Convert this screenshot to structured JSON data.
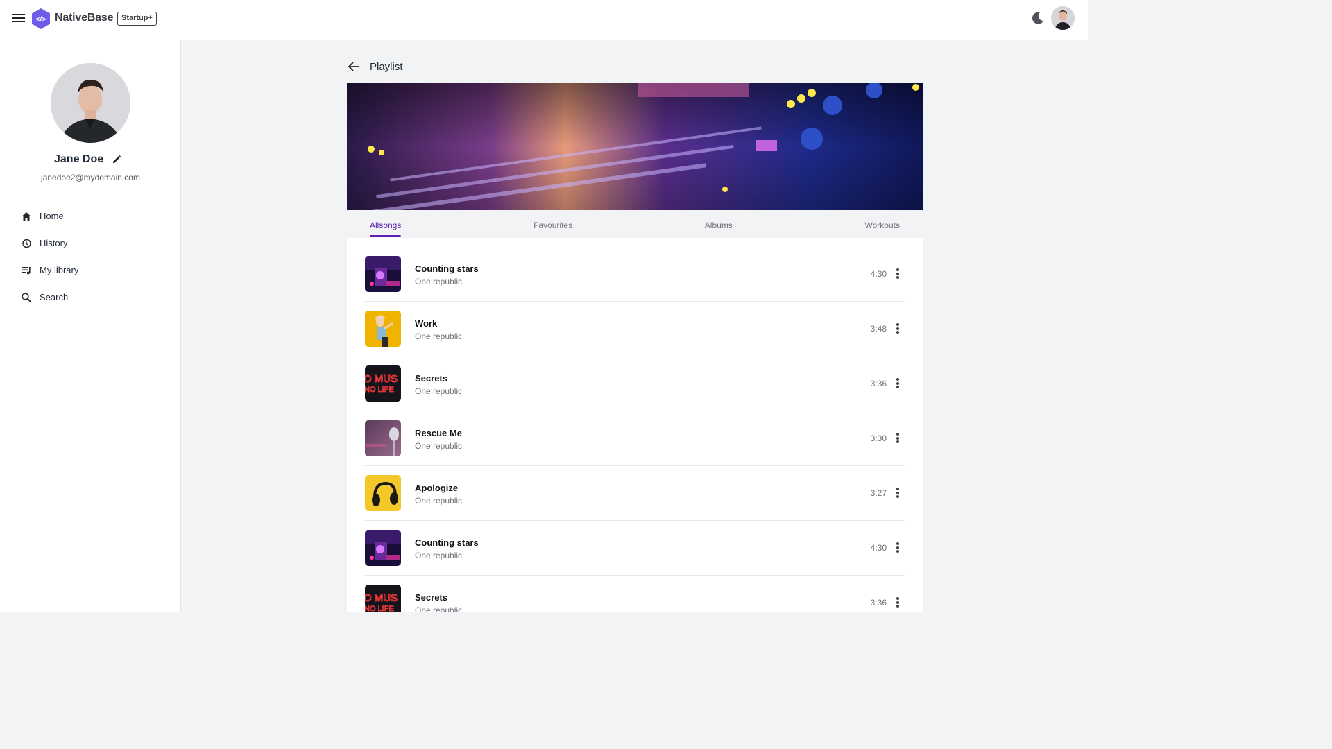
{
  "topbar": {
    "brand": "NativeBase",
    "badge": "Startup+"
  },
  "sidebar": {
    "profile_name": "Jane Doe",
    "profile_email": "janedoe2@mydomain.com",
    "nav": [
      {
        "label": "Home",
        "icon": "home-icon"
      },
      {
        "label": "History",
        "icon": "history-icon"
      },
      {
        "label": "My library",
        "icon": "library-icon"
      },
      {
        "label": "Search",
        "icon": "search-icon"
      }
    ]
  },
  "main": {
    "title": "Playlist",
    "tabs": [
      {
        "label": "Allsongs",
        "active": true
      },
      {
        "label": "Favourites",
        "active": false
      },
      {
        "label": "Albums",
        "active": false
      },
      {
        "label": "Workouts",
        "active": false
      }
    ],
    "songs": [
      {
        "title": "Counting stars",
        "artist": "One republic",
        "duration": "4:30",
        "thumb": "dj-purple"
      },
      {
        "title": "Work",
        "artist": "One republic",
        "duration": "3:48",
        "thumb": "yellow-dancer"
      },
      {
        "title": "Secrets",
        "artist": "One republic",
        "duration": "3:36",
        "thumb": "neon-sign"
      },
      {
        "title": "Rescue Me",
        "artist": "One republic",
        "duration": "3:30",
        "thumb": "microphone"
      },
      {
        "title": "Apologize",
        "artist": "One republic",
        "duration": "3:27",
        "thumb": "headphones"
      },
      {
        "title": "Counting stars",
        "artist": "One republic",
        "duration": "4:30",
        "thumb": "dj-purple"
      },
      {
        "title": "Secrets",
        "artist": "One republic",
        "duration": "3:36",
        "thumb": "neon-sign"
      }
    ]
  },
  "colors": {
    "accent": "#5b21b6",
    "logo": "#6d5ce8"
  }
}
